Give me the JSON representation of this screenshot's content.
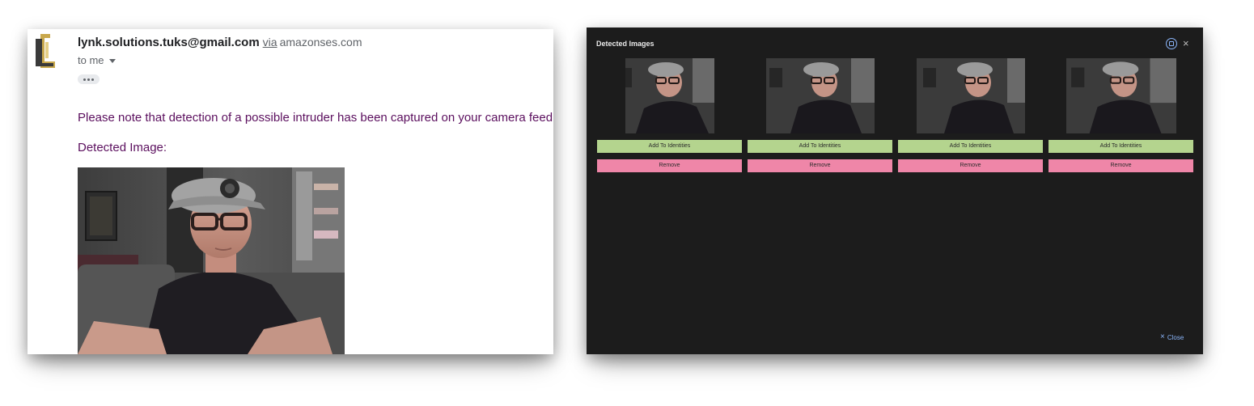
{
  "email": {
    "sender_name": "lynk.solutions.tuks@gmail.com",
    "via_label": "via",
    "via_domain": "amazonses.com",
    "to_label": "to me",
    "body_line1": "Please note that detection of a possible intruder has been captured on your camera feed.",
    "body_line2": "Detected Image:",
    "icons": {
      "logo": "company-logo",
      "recipients_toggle": "chevron-down-icon",
      "more": "ellipsis-icon"
    },
    "colors": {
      "body_text": "#5b0f5e"
    }
  },
  "modal": {
    "title": "Detected Images",
    "icons": {
      "expand": "expand-icon",
      "close": "close-icon"
    },
    "cards": [
      {
        "add_label": "Add To Identities",
        "remove_label": "Remove"
      },
      {
        "add_label": "Add To Identities",
        "remove_label": "Remove"
      },
      {
        "add_label": "Add To Identities",
        "remove_label": "Remove"
      },
      {
        "add_label": "Add To Identities",
        "remove_label": "Remove"
      }
    ],
    "close_label": "Close",
    "colors": {
      "background": "#1c1c1c",
      "add_button": "#b4d48e",
      "remove_button": "#ef86a8",
      "link": "#8ab4f8"
    }
  }
}
